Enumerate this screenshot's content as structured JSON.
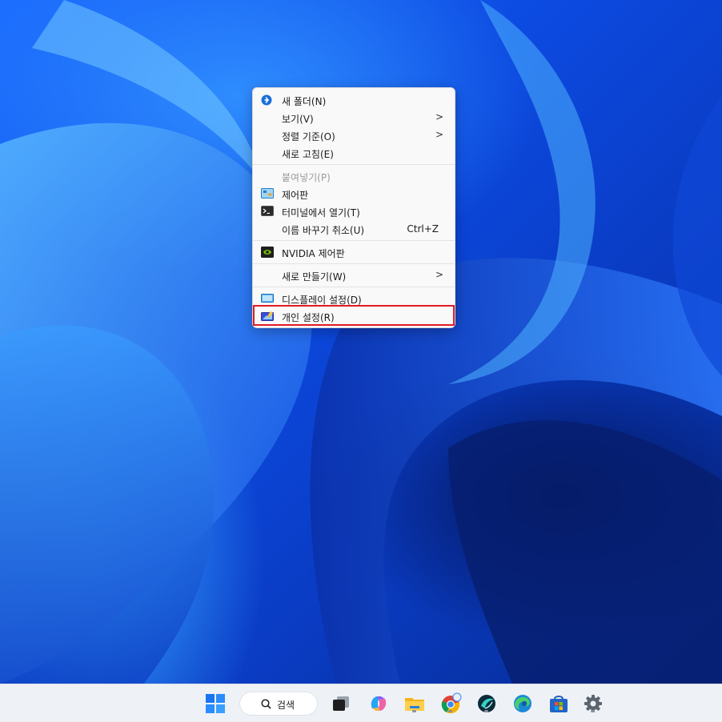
{
  "context_menu": {
    "items": [
      {
        "label": "새 폴더(N)",
        "icon": "new-folder-icon",
        "chevron": false,
        "shortcut": "",
        "disabled": false
      },
      {
        "label": "보기(V)",
        "icon": "",
        "chevron": true,
        "shortcut": "",
        "disabled": false
      },
      {
        "label": "정렬 기준(O)",
        "icon": "",
        "chevron": true,
        "shortcut": "",
        "disabled": false
      },
      {
        "label": "새로 고침(E)",
        "icon": "",
        "chevron": false,
        "shortcut": "",
        "disabled": false
      },
      {
        "label": "붙여넣기(P)",
        "icon": "",
        "chevron": false,
        "shortcut": "",
        "disabled": true
      },
      {
        "label": "제어판",
        "icon": "control-panel-icon",
        "chevron": false,
        "shortcut": "",
        "disabled": false
      },
      {
        "label": "터미널에서 열기(T)",
        "icon": "terminal-icon",
        "chevron": false,
        "shortcut": "",
        "disabled": false
      },
      {
        "label": "이름 바꾸기 취소(U)",
        "icon": "",
        "chevron": false,
        "shortcut": "Ctrl+Z",
        "disabled": false
      },
      {
        "label": "NVIDIA 제어판",
        "icon": "nvidia-icon",
        "chevron": false,
        "shortcut": "",
        "disabled": false
      },
      {
        "label": "새로 만들기(W)",
        "icon": "",
        "chevron": true,
        "shortcut": "",
        "disabled": false
      },
      {
        "label": "디스플레이 설정(D)",
        "icon": "display-icon",
        "chevron": false,
        "shortcut": "",
        "disabled": false
      },
      {
        "label": "개인 설정(R)",
        "icon": "personalize-icon",
        "chevron": false,
        "shortcut": "",
        "disabled": false
      }
    ],
    "chevron_glyph": ">",
    "highlighted_item": "개인 설정(R)"
  },
  "taskbar": {
    "search_label": "검색",
    "apps": [
      "start-icon",
      "task-view-icon",
      "copilot-icon",
      "file-explorer-icon",
      "chrome-icon",
      "app-icon",
      "edge-icon",
      "store-icon",
      "settings-icon"
    ]
  },
  "colors": {
    "highlight_border": "#e01b24",
    "menu_bg": "#f9f9f9",
    "taskbar_bg": "#eef1f6"
  }
}
